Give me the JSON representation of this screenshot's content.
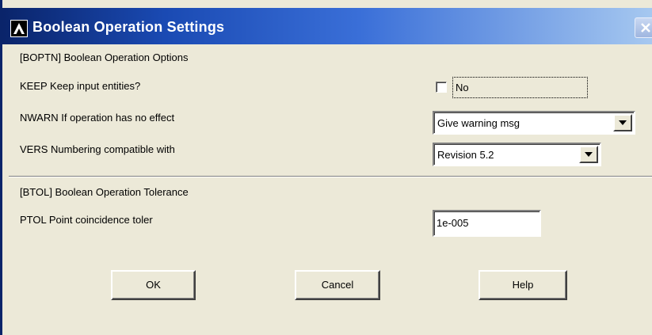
{
  "window": {
    "title": "Boolean Operation Settings",
    "icons": {
      "app": "ansys-logo-icon",
      "close": "close-icon"
    }
  },
  "section1": {
    "header": "[BOPTN]  Boolean Operation Options",
    "keep": {
      "label": "KEEP  Keep input entities?",
      "checkbox_text": "No",
      "checked": false
    },
    "nwarn": {
      "label": "NWARN  If operation has no effect",
      "value": "Give warning msg"
    },
    "vers": {
      "label": "VERS  Numbering compatible with",
      "value": "Revision 5.2"
    }
  },
  "section2": {
    "header": "[BTOL]  Boolean Operation Tolerance",
    "ptol": {
      "label": "PTOL  Point coincidence toler",
      "value": "1e-005"
    }
  },
  "buttons": {
    "ok": "OK",
    "cancel": "Cancel",
    "help": "Help"
  },
  "colors": {
    "title_start": "#0a246a",
    "title_end": "#a6c8f0",
    "dialog_bg": "#ece9d8"
  }
}
